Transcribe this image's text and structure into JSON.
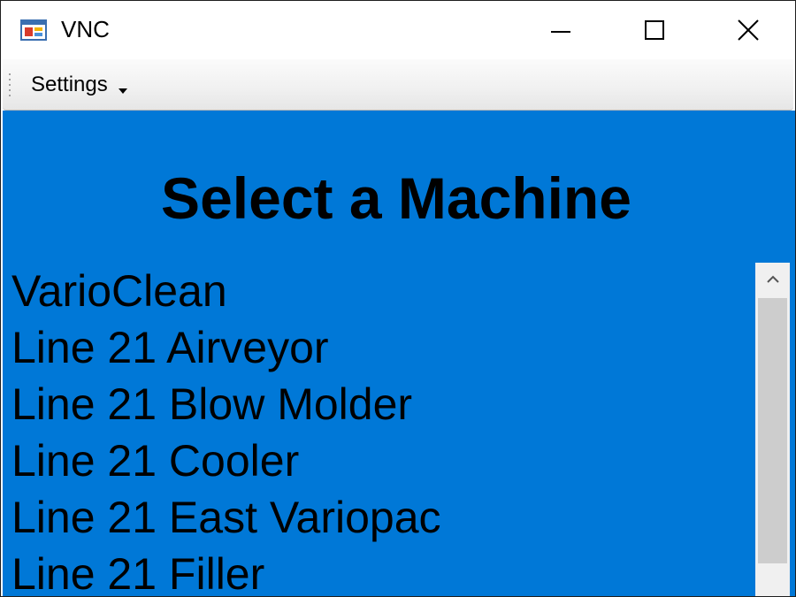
{
  "window": {
    "title": "VNC",
    "icon": "app-window-icon"
  },
  "title_buttons": {
    "minimize": "minimize-icon",
    "maximize": "maximize-icon",
    "close": "close-icon"
  },
  "toolbar": {
    "settings_label": "Settings",
    "settings_icon": "chevron-down-icon"
  },
  "main": {
    "heading": "Select a Machine",
    "background_color": "#0078d7",
    "machines": [
      "VarioClean",
      "Line 21 Airveyor",
      "Line 21 Blow Molder",
      "Line 21 Cooler",
      "Line 21 East Variopac",
      "Line 21 Filler"
    ]
  }
}
